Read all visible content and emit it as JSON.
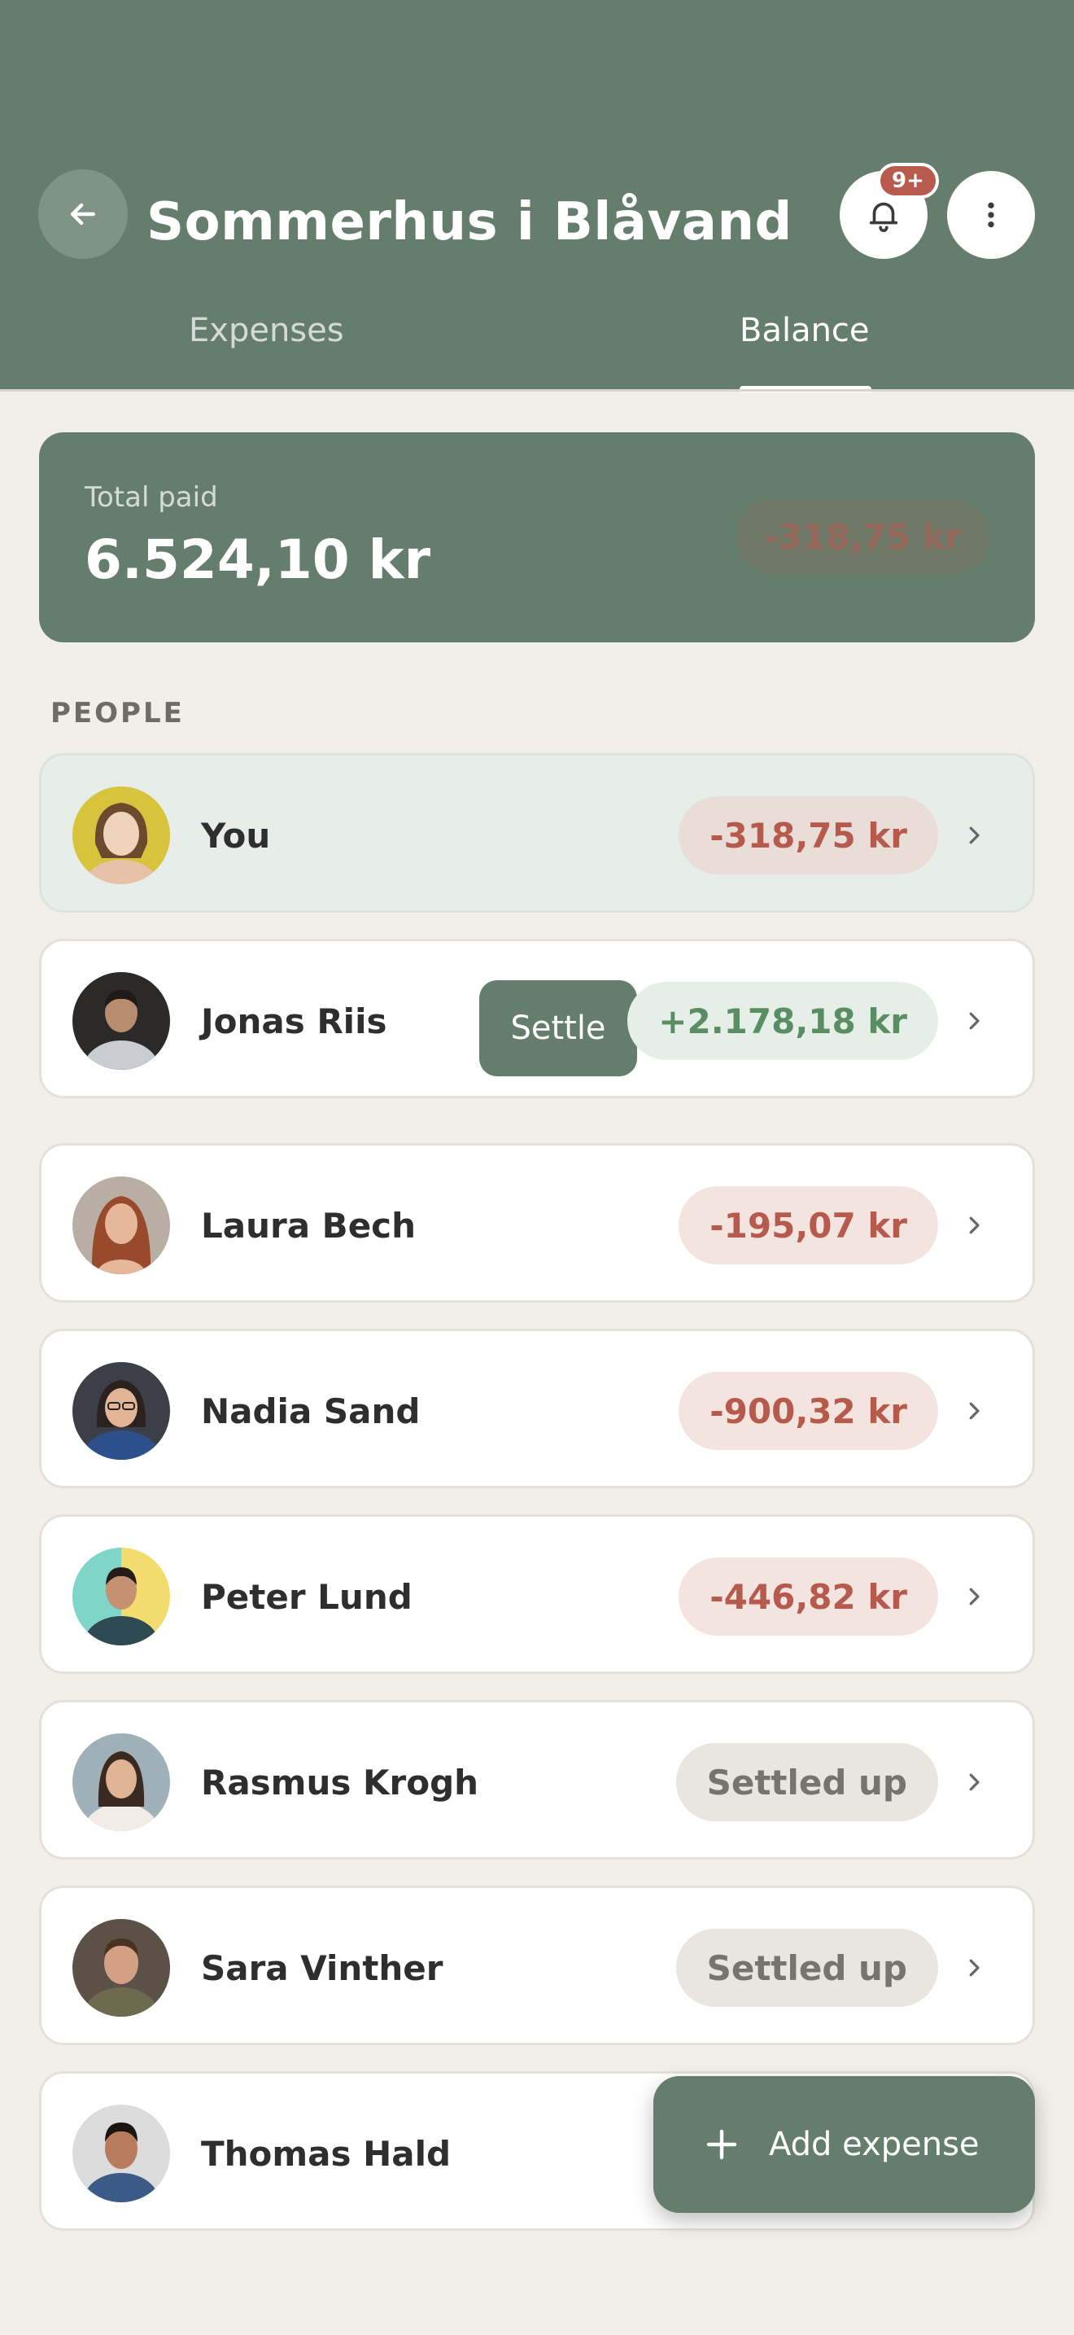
{
  "header": {
    "title": "Sommerhus i Blåvand",
    "notification_badge": "9+",
    "tabs": [
      {
        "label": "Expenses",
        "active": false
      },
      {
        "label": "Balance",
        "active": true
      }
    ]
  },
  "summary": {
    "label": "Total paid",
    "value": "6.524,10 kr",
    "balance": "-318,75 kr"
  },
  "people_section": {
    "label": "PEOPLE",
    "people": [
      {
        "name": "You",
        "amount": "-318,75 kr",
        "status": "negative"
      },
      {
        "name": "Jonas Riis",
        "amount": "+2.178,18 kr",
        "status": "positive",
        "action": "Settle"
      },
      {
        "name": "Laura Bech",
        "amount": "-195,07 kr",
        "status": "negative"
      },
      {
        "name": "Nadia Sand",
        "amount": "-900,32 kr",
        "status": "negative"
      },
      {
        "name": "Peter Lund",
        "amount": "-446,82 kr",
        "status": "negative"
      },
      {
        "name": "Rasmus Krogh",
        "amount": "Settled up",
        "status": "settled"
      },
      {
        "name": "Sara Vinther",
        "amount": "Settled up",
        "status": "settled"
      },
      {
        "name": "Thomas Hald",
        "amount": "",
        "status": "hidden"
      }
    ]
  },
  "fab": {
    "label": "Add expense"
  },
  "colors": {
    "header_green": "#657d6c",
    "background": "#f2efe9",
    "negative": "#b55a4c",
    "positive": "#5b8d63",
    "badge": "#b85a4e"
  }
}
